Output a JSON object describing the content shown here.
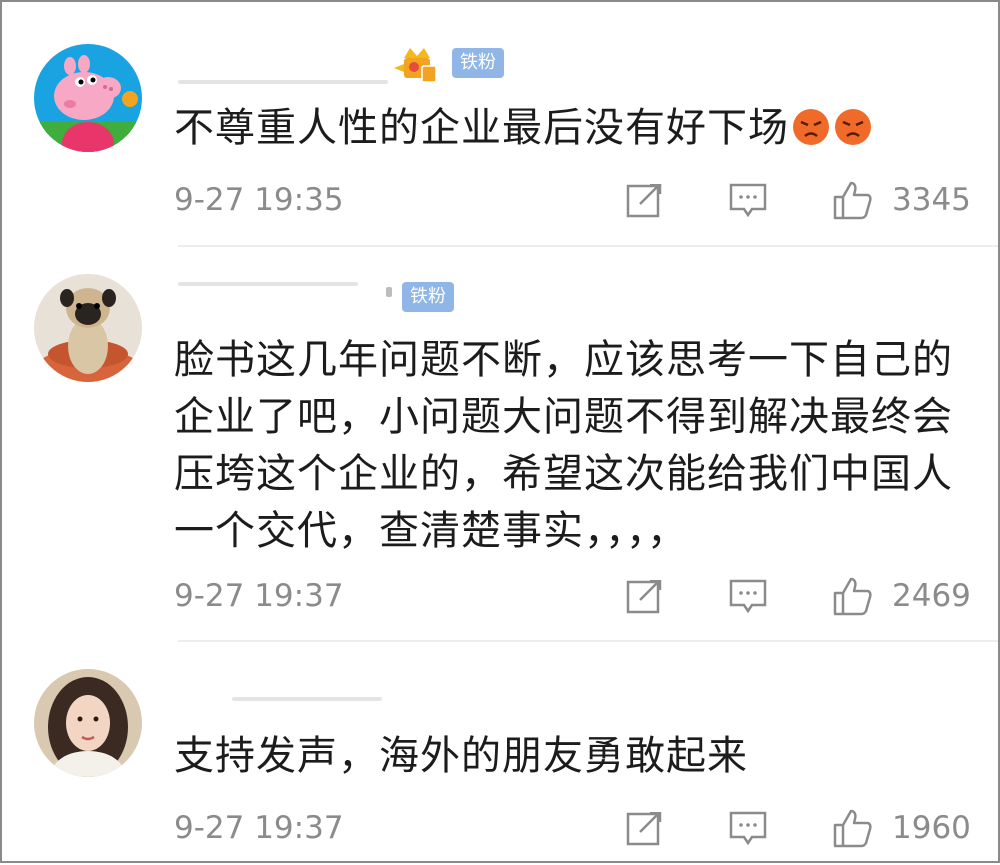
{
  "comments": [
    {
      "badge": "铁粉",
      "text": "不尊重人性的企业最后没有好下场",
      "emojis": [
        "angry-emoji",
        "angry-emoji"
      ],
      "time": "9-27 19:35",
      "likes": "3345"
    },
    {
      "badge": "铁粉",
      "text": "脸书这几年问题不断，应该思考一下自己的企业了吧，小问题大问题不得到解决最终会压垮这个企业的，希望这次能给我们中国人一个交代，查清楚事实，，，，",
      "time": "9-27 19:37",
      "likes": "2469"
    },
    {
      "text": "支持发声，海外的朋友勇敢起来",
      "time": "9-27 19:37",
      "likes": "1960"
    }
  ],
  "icons": {
    "share": "share-icon",
    "reply": "comment-icon",
    "like": "thumbs-up-icon",
    "vip": "crown-badge-icon"
  },
  "colors": {
    "badge_bg": "#8fb6e6",
    "meta_text": "#8b8b8b",
    "divider": "#ededed"
  }
}
